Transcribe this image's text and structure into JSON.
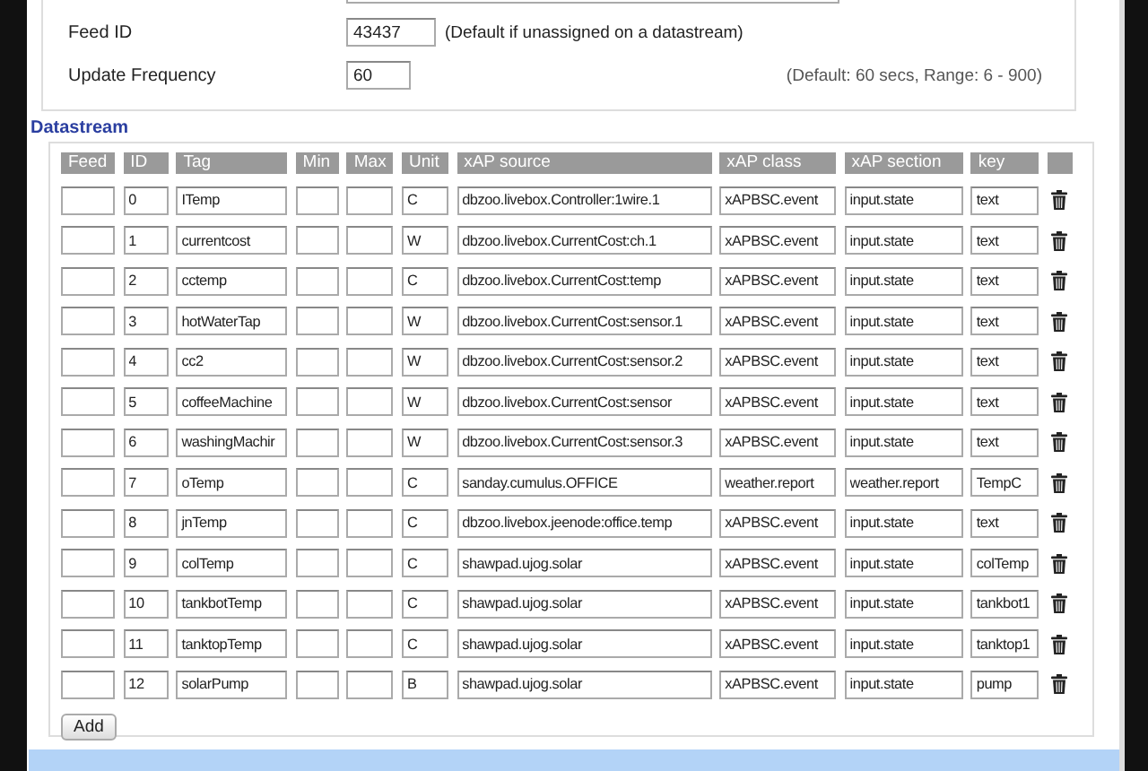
{
  "settings": [
    {
      "label": "Feed ID",
      "value": "43437",
      "hint": "(Default if unassigned on a datastream)",
      "kind": "inline"
    },
    {
      "label": "Update Frequency",
      "value": "60",
      "hint": "(Default: 60 secs, Range: 6 - 900)",
      "kind": "aside"
    }
  ],
  "datastream": {
    "legend": "Datastream",
    "columns": [
      "Feed",
      "ID",
      "Tag",
      "Min",
      "Max",
      "Unit",
      "xAP source",
      "xAP class",
      "xAP section",
      "key"
    ],
    "rows": [
      {
        "id": "0",
        "tag": "ITemp",
        "unit": "C",
        "source": "dbzoo.livebox.Controller:1wire.1",
        "class": "xAPBSC.event",
        "section": "input.state",
        "key": "text"
      },
      {
        "id": "1",
        "tag": "currentcost",
        "unit": "W",
        "source": "dbzoo.livebox.CurrentCost:ch.1",
        "class": "xAPBSC.event",
        "section": "input.state",
        "key": "text"
      },
      {
        "id": "2",
        "tag": "cctemp",
        "unit": "C",
        "source": "dbzoo.livebox.CurrentCost:temp",
        "class": "xAPBSC.event",
        "section": "input.state",
        "key": "text"
      },
      {
        "id": "3",
        "tag": "hotWaterTap",
        "unit": "W",
        "source": "dbzoo.livebox.CurrentCost:sensor.1",
        "class": "xAPBSC.event",
        "section": "input.state",
        "key": "text"
      },
      {
        "id": "4",
        "tag": "cc2",
        "unit": "W",
        "source": "dbzoo.livebox.CurrentCost:sensor.2",
        "class": "xAPBSC.event",
        "section": "input.state",
        "key": "text"
      },
      {
        "id": "5",
        "tag": "coffeeMachine",
        "unit": "W",
        "source": "dbzoo.livebox.CurrentCost:sensor",
        "class": "xAPBSC.event",
        "section": "input.state",
        "key": "text"
      },
      {
        "id": "6",
        "tag": "washingMachir",
        "unit": "W",
        "source": "dbzoo.livebox.CurrentCost:sensor.3",
        "class": "xAPBSC.event",
        "section": "input.state",
        "key": "text"
      },
      {
        "id": "7",
        "tag": "oTemp",
        "unit": "C",
        "source": "sanday.cumulus.OFFICE",
        "class": "weather.report",
        "section": "weather.report",
        "key": "TempC"
      },
      {
        "id": "8",
        "tag": "jnTemp",
        "unit": "C",
        "source": "dbzoo.livebox.jeenode:office.temp",
        "class": "xAPBSC.event",
        "section": "input.state",
        "key": "text"
      },
      {
        "id": "9",
        "tag": "colTemp",
        "unit": "C",
        "source": "shawpad.ujog.solar",
        "class": "xAPBSC.event",
        "section": "input.state",
        "key": "colTemp"
      },
      {
        "id": "10",
        "tag": "tankbotTemp",
        "unit": "C",
        "source": "shawpad.ujog.solar",
        "class": "xAPBSC.event",
        "section": "input.state",
        "key": "tankbot1"
      },
      {
        "id": "11",
        "tag": "tanktopTemp",
        "unit": "C",
        "source": "shawpad.ujog.solar",
        "class": "xAPBSC.event",
        "section": "input.state",
        "key": "tanktop1"
      },
      {
        "id": "12",
        "tag": "solarPump",
        "unit": "B",
        "source": "shawpad.ujog.solar",
        "class": "xAPBSC.event",
        "section": "input.state",
        "key": "pump"
      }
    ],
    "add_button": "Add"
  }
}
